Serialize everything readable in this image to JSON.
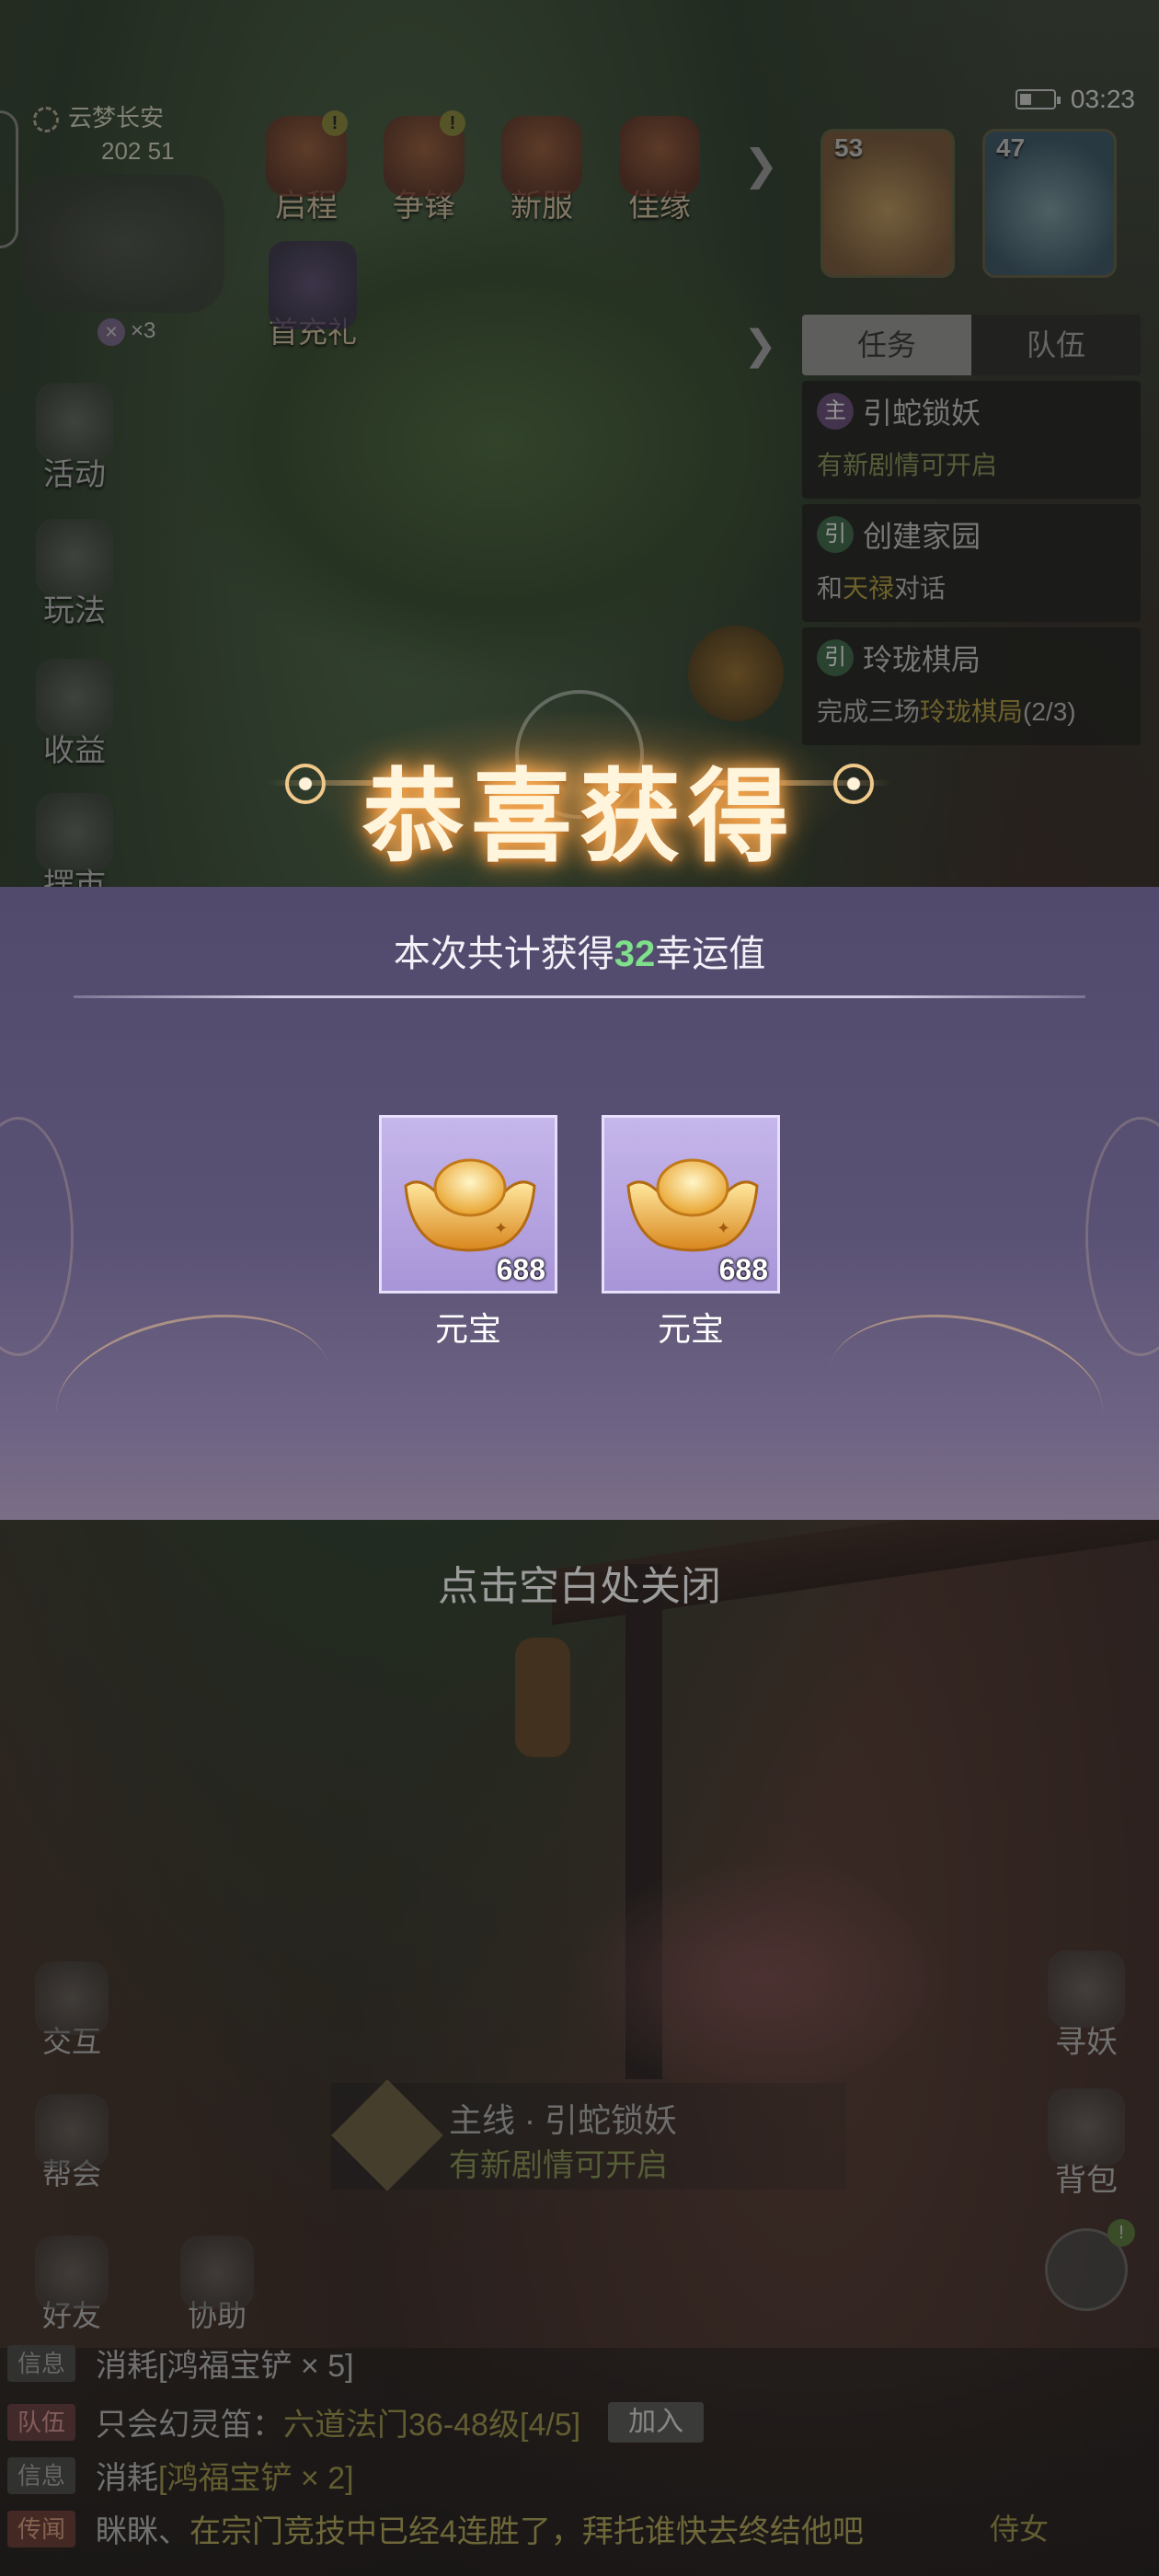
{
  "status_bar": {
    "time": "03:23"
  },
  "location": {
    "name": "云梦长安",
    "coords": "202 51"
  },
  "companion_count": "×3",
  "top_icons": [
    {
      "label": "启程",
      "badge": "!"
    },
    {
      "label": "争锋",
      "badge": "!"
    },
    {
      "label": "新服",
      "badge": ""
    },
    {
      "label": "佳缘",
      "badge": ""
    }
  ],
  "first_recharge": {
    "label": "首充礼"
  },
  "party_avatars": [
    {
      "level": "53"
    },
    {
      "level": "47"
    }
  ],
  "task_panel": {
    "tabs": [
      "任务",
      "队伍"
    ],
    "items": [
      {
        "tag": "主",
        "title": "引蛇锁妖",
        "desc": "有新剧情可开启"
      },
      {
        "tag": "引",
        "title": "创建家园",
        "desc_prefix": "和",
        "desc_hl": "天禄",
        "desc_suffix": "对话"
      },
      {
        "tag": "引",
        "title": "玲珑棋局",
        "desc_prefix": "完成三场",
        "desc_hl": "玲珑棋局",
        "desc_suffix": "(2/3)"
      }
    ]
  },
  "left_sidebar": [
    "活动",
    "玩法",
    "收益",
    "摆市"
  ],
  "right_sidebar": [
    "寻妖",
    "背包"
  ],
  "reward_popup": {
    "title": "恭喜获得",
    "summary_prefix": "本次共计获得",
    "summary_value": "32",
    "summary_suffix": "幸运值",
    "items": [
      {
        "name": "元宝",
        "qty": "688",
        "icon": "gold-ingot-icon"
      },
      {
        "name": "元宝",
        "qty": "688",
        "icon": "gold-ingot-icon"
      }
    ],
    "close_hint": "点击空白处关闭"
  },
  "main_quest": {
    "title": "主线 · 引蛇锁妖",
    "desc": "有新剧情可开启"
  },
  "bottom_buttons": {
    "interact": "交互",
    "guild": "帮会",
    "friends": "好友",
    "assist": "协助"
  },
  "chat": [
    {
      "tag": "信息",
      "text": "消耗[鸿福宝铲 × 5]"
    },
    {
      "tag": "队伍",
      "text_a": "只会幻灵笛：",
      "text_b": "六道法门36-48级[4/5]",
      "join": "加入"
    },
    {
      "tag": "信息",
      "text_a": "消耗",
      "text_b": "[鸿福宝铲 × 2]"
    },
    {
      "tag": "传闻",
      "text_a": "眯眯、",
      "text_b": "在宗门竞技中已经4连胜了，拜托谁快去终结他吧"
    }
  ],
  "bottom_right_label": "侍女",
  "colors": {
    "accent_green": "#7ee08a",
    "panel_purple": "#5a5275",
    "item_border": "#e6defa"
  }
}
